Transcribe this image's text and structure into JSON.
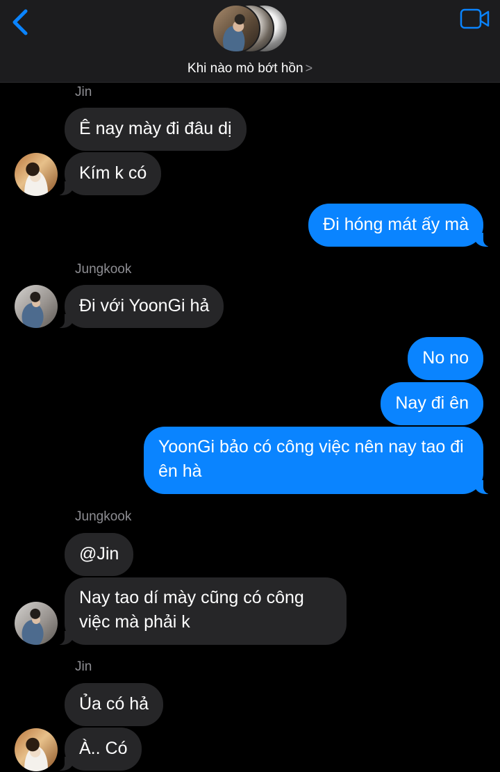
{
  "header": {
    "title": "Khi nào mò bớt hồn",
    "chevron": ">",
    "back_icon": "chevron-left-icon",
    "video_icon": "video-camera-icon",
    "accent": "#0a84ff"
  },
  "messages": [
    {
      "sender": "Jin"
    },
    {
      "text": "Ê nay mày đi đâu dị"
    },
    {
      "text": "Kím k có"
    },
    {
      "text": "Đi hóng mát ấy mà"
    },
    {
      "sender": "Jungkook"
    },
    {
      "text": "Đi với YoonGi hả"
    },
    {
      "text": "No no"
    },
    {
      "text": "Nay đi ên"
    },
    {
      "text": "YoonGi bảo có công việc nên nay tao đi ên hà"
    },
    {
      "sender": "Jungkook"
    },
    {
      "text": "@Jin"
    },
    {
      "text": "Nay tao dí mày cũng có công việc mà phải k"
    },
    {
      "sender": "Jin"
    },
    {
      "text": "Ủa có hả"
    },
    {
      "text": "À.. Có"
    }
  ],
  "colors": {
    "incoming_bubble": "#262628",
    "outgoing_bubble": "#0a84ff",
    "sender_label": "#8e8e93",
    "header_bg": "#1c1c1e"
  }
}
